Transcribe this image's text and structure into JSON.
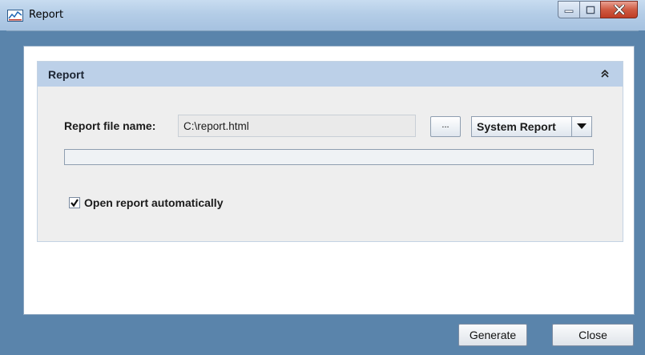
{
  "window": {
    "title": "Report",
    "icon": "app-report-icon"
  },
  "panel": {
    "title": "Report",
    "collapse_icon": "double-chevron-up-icon",
    "filename_label": "Report file name:",
    "filename_value": "C:\\report.html",
    "browse_label": "...",
    "report_type_selected": "System Report",
    "progress_fraction": 0,
    "open_automatically_checked": true,
    "open_automatically_label": "Open report automatically"
  },
  "footer": {
    "generate_label": "Generate",
    "close_label": "Close"
  }
}
